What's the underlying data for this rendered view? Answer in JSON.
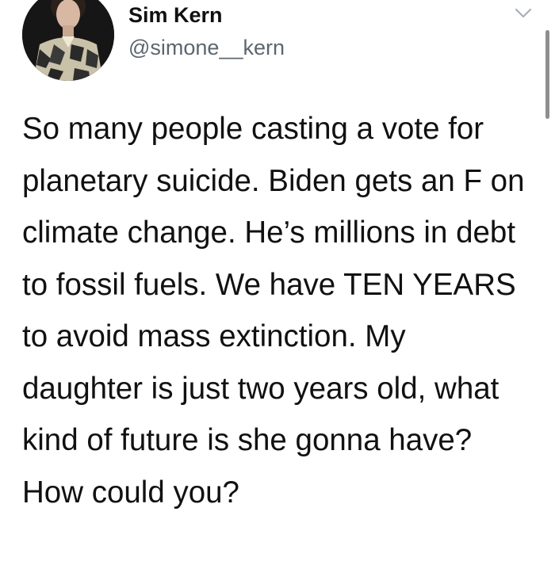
{
  "author": {
    "display_name": "Sim Kern",
    "handle": "@simone__kern"
  },
  "icons": {
    "avatar": "profile-photo",
    "menu": "chevron-down-icon"
  },
  "tweet": {
    "text": "So many people casting a vote for planetary suicide. Biden gets an F on climate change. He’s millions in debt to fossil fuels. We have TEN YEARS to avoid mass extinction. My daughter is just two years old, what kind of future is she gonna have? How could you?"
  },
  "colors": {
    "text": "#111111",
    "handle": "#5b6670",
    "background": "#ffffff"
  }
}
